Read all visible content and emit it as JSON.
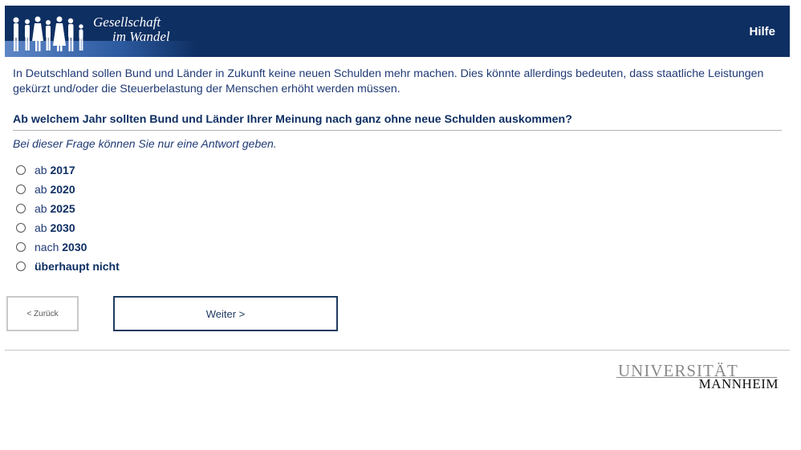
{
  "header": {
    "logo_line1": "Gesellschaft",
    "logo_line2": "im Wandel",
    "help_label": "Hilfe"
  },
  "intro": "In Deutschland sollen Bund und Länder in Zukunft keine neuen Schulden mehr machen. Dies könnte allerdings bedeuten, dass staatliche Leistungen gekürzt und/oder die Steuerbelastung der Menschen erhöht werden müssen.",
  "question": "Ab welchem Jahr sollten Bund und Länder Ihrer Meinung nach ganz ohne neue Schulden auskommen?",
  "hint": "Bei dieser Frage können Sie nur eine Antwort geben.",
  "options": [
    {
      "prefix": "ab",
      "value": "2017"
    },
    {
      "prefix": "ab",
      "value": "2020"
    },
    {
      "prefix": "ab",
      "value": "2025"
    },
    {
      "prefix": "ab",
      "value": "2030"
    },
    {
      "prefix": "nach",
      "value": "2030"
    },
    {
      "prefix": "",
      "value": "überhaupt nicht"
    }
  ],
  "buttons": {
    "back": "< Zurück",
    "next": "Weiter >"
  },
  "footer": {
    "uni_line1": "UNIVERSITÄT",
    "uni_line2": "MANNHEIM"
  },
  "colors": {
    "header_bg": "#0e2f62",
    "text": "#1f3a75"
  }
}
